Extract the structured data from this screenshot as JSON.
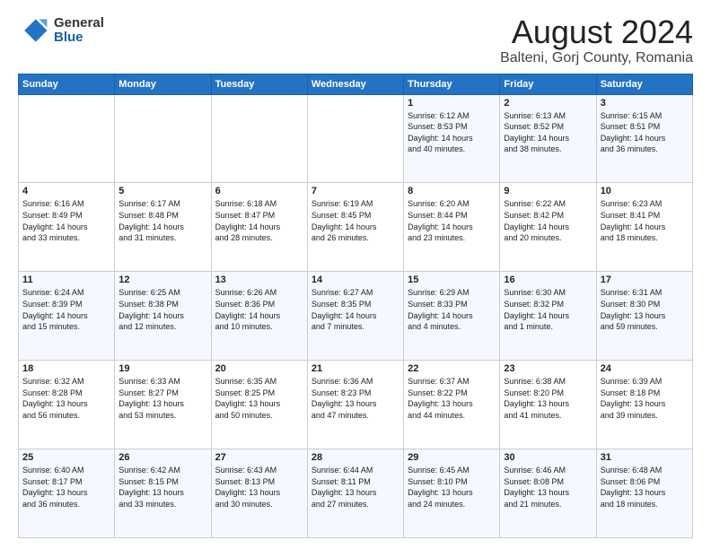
{
  "logo": {
    "general": "General",
    "blue": "Blue"
  },
  "title": "August 2024",
  "subtitle": "Balteni, Gorj County, Romania",
  "header_days": [
    "Sunday",
    "Monday",
    "Tuesday",
    "Wednesday",
    "Thursday",
    "Friday",
    "Saturday"
  ],
  "weeks": [
    [
      {
        "day": "",
        "info": ""
      },
      {
        "day": "",
        "info": ""
      },
      {
        "day": "",
        "info": ""
      },
      {
        "day": "",
        "info": ""
      },
      {
        "day": "1",
        "info": "Sunrise: 6:12 AM\nSunset: 8:53 PM\nDaylight: 14 hours\nand 40 minutes."
      },
      {
        "day": "2",
        "info": "Sunrise: 6:13 AM\nSunset: 8:52 PM\nDaylight: 14 hours\nand 38 minutes."
      },
      {
        "day": "3",
        "info": "Sunrise: 6:15 AM\nSunset: 8:51 PM\nDaylight: 14 hours\nand 36 minutes."
      }
    ],
    [
      {
        "day": "4",
        "info": "Sunrise: 6:16 AM\nSunset: 8:49 PM\nDaylight: 14 hours\nand 33 minutes."
      },
      {
        "day": "5",
        "info": "Sunrise: 6:17 AM\nSunset: 8:48 PM\nDaylight: 14 hours\nand 31 minutes."
      },
      {
        "day": "6",
        "info": "Sunrise: 6:18 AM\nSunset: 8:47 PM\nDaylight: 14 hours\nand 28 minutes."
      },
      {
        "day": "7",
        "info": "Sunrise: 6:19 AM\nSunset: 8:45 PM\nDaylight: 14 hours\nand 26 minutes."
      },
      {
        "day": "8",
        "info": "Sunrise: 6:20 AM\nSunset: 8:44 PM\nDaylight: 14 hours\nand 23 minutes."
      },
      {
        "day": "9",
        "info": "Sunrise: 6:22 AM\nSunset: 8:42 PM\nDaylight: 14 hours\nand 20 minutes."
      },
      {
        "day": "10",
        "info": "Sunrise: 6:23 AM\nSunset: 8:41 PM\nDaylight: 14 hours\nand 18 minutes."
      }
    ],
    [
      {
        "day": "11",
        "info": "Sunrise: 6:24 AM\nSunset: 8:39 PM\nDaylight: 14 hours\nand 15 minutes."
      },
      {
        "day": "12",
        "info": "Sunrise: 6:25 AM\nSunset: 8:38 PM\nDaylight: 14 hours\nand 12 minutes."
      },
      {
        "day": "13",
        "info": "Sunrise: 6:26 AM\nSunset: 8:36 PM\nDaylight: 14 hours\nand 10 minutes."
      },
      {
        "day": "14",
        "info": "Sunrise: 6:27 AM\nSunset: 8:35 PM\nDaylight: 14 hours\nand 7 minutes."
      },
      {
        "day": "15",
        "info": "Sunrise: 6:29 AM\nSunset: 8:33 PM\nDaylight: 14 hours\nand 4 minutes."
      },
      {
        "day": "16",
        "info": "Sunrise: 6:30 AM\nSunset: 8:32 PM\nDaylight: 14 hours\nand 1 minute."
      },
      {
        "day": "17",
        "info": "Sunrise: 6:31 AM\nSunset: 8:30 PM\nDaylight: 13 hours\nand 59 minutes."
      }
    ],
    [
      {
        "day": "18",
        "info": "Sunrise: 6:32 AM\nSunset: 8:28 PM\nDaylight: 13 hours\nand 56 minutes."
      },
      {
        "day": "19",
        "info": "Sunrise: 6:33 AM\nSunset: 8:27 PM\nDaylight: 13 hours\nand 53 minutes."
      },
      {
        "day": "20",
        "info": "Sunrise: 6:35 AM\nSunset: 8:25 PM\nDaylight: 13 hours\nand 50 minutes."
      },
      {
        "day": "21",
        "info": "Sunrise: 6:36 AM\nSunset: 8:23 PM\nDaylight: 13 hours\nand 47 minutes."
      },
      {
        "day": "22",
        "info": "Sunrise: 6:37 AM\nSunset: 8:22 PM\nDaylight: 13 hours\nand 44 minutes."
      },
      {
        "day": "23",
        "info": "Sunrise: 6:38 AM\nSunset: 8:20 PM\nDaylight: 13 hours\nand 41 minutes."
      },
      {
        "day": "24",
        "info": "Sunrise: 6:39 AM\nSunset: 8:18 PM\nDaylight: 13 hours\nand 39 minutes."
      }
    ],
    [
      {
        "day": "25",
        "info": "Sunrise: 6:40 AM\nSunset: 8:17 PM\nDaylight: 13 hours\nand 36 minutes."
      },
      {
        "day": "26",
        "info": "Sunrise: 6:42 AM\nSunset: 8:15 PM\nDaylight: 13 hours\nand 33 minutes."
      },
      {
        "day": "27",
        "info": "Sunrise: 6:43 AM\nSunset: 8:13 PM\nDaylight: 13 hours\nand 30 minutes."
      },
      {
        "day": "28",
        "info": "Sunrise: 6:44 AM\nSunset: 8:11 PM\nDaylight: 13 hours\nand 27 minutes."
      },
      {
        "day": "29",
        "info": "Sunrise: 6:45 AM\nSunset: 8:10 PM\nDaylight: 13 hours\nand 24 minutes."
      },
      {
        "day": "30",
        "info": "Sunrise: 6:46 AM\nSunset: 8:08 PM\nDaylight: 13 hours\nand 21 minutes."
      },
      {
        "day": "31",
        "info": "Sunrise: 6:48 AM\nSunset: 8:06 PM\nDaylight: 13 hours\nand 18 minutes."
      }
    ]
  ]
}
